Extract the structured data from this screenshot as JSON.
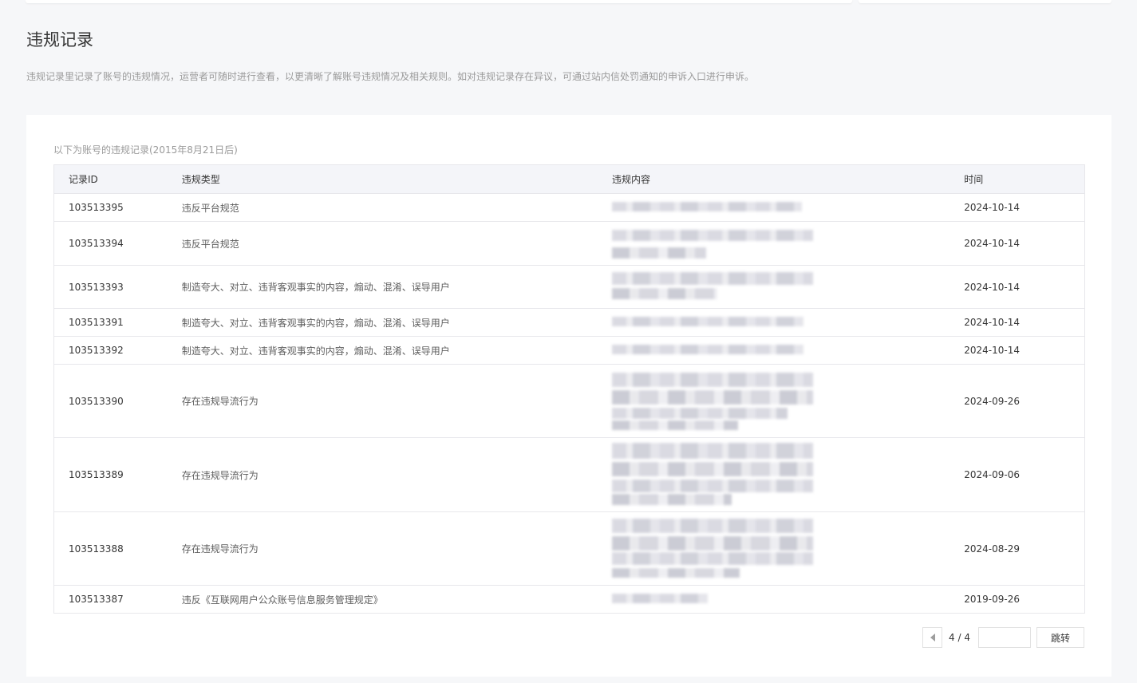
{
  "header": {
    "title": "违规记录",
    "description": "违规记录里记录了账号的违规情况，运营者可随时进行查看，以更清晰了解账号违规情况及相关规则。如对违规记录存在异议，可通过站内信处罚通知的申诉入口进行申诉。"
  },
  "records": {
    "note": "以下为账号的违规记录(2015年8月21日后)",
    "columns": {
      "id": "记录ID",
      "type": "违规类型",
      "content": "违规内容",
      "time": "时间"
    },
    "rows": [
      {
        "id": "103513395",
        "type": "违反平台规范",
        "time": "2024-10-14"
      },
      {
        "id": "103513394",
        "type": "违反平台规范",
        "time": "2024-10-14"
      },
      {
        "id": "103513393",
        "type": "制造夸大、对立、违背客观事实的内容，煽动、混淆、误导用户",
        "time": "2024-10-14"
      },
      {
        "id": "103513391",
        "type": "制造夸大、对立、违背客观事实的内容，煽动、混淆、误导用户",
        "time": "2024-10-14"
      },
      {
        "id": "103513392",
        "type": "制造夸大、对立、违背客观事实的内容，煽动、混淆、误导用户",
        "time": "2024-10-14"
      },
      {
        "id": "103513390",
        "type": "存在违规导流行为",
        "time": "2024-09-26"
      },
      {
        "id": "103513389",
        "type": "存在违规导流行为",
        "time": "2024-09-06"
      },
      {
        "id": "103513388",
        "type": "存在违规导流行为",
        "time": "2024-08-29"
      },
      {
        "id": "103513387",
        "type": "违反《互联网用户公众账号信息服务管理规定》",
        "time": "2019-09-26"
      }
    ]
  },
  "pagination": {
    "page_count": "4 / 4",
    "jump_input_value": "",
    "jump_label": "跳转",
    "prev_icon": "caret-left-icon"
  }
}
